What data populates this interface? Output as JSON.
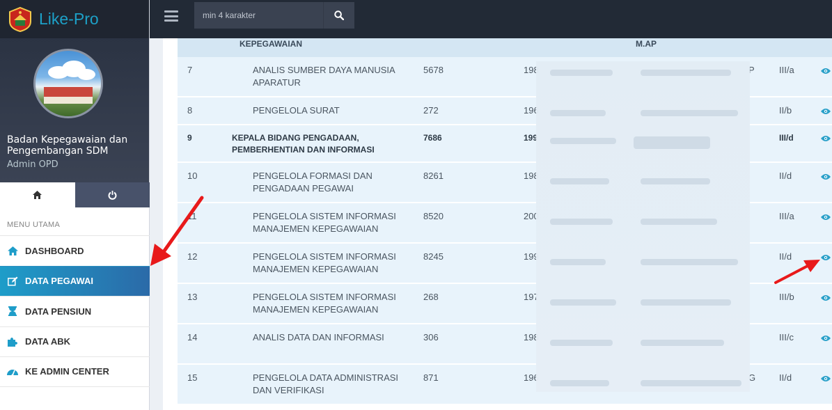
{
  "app": {
    "title": "Like-Pro"
  },
  "search": {
    "placeholder": "min 4 karakter"
  },
  "profile": {
    "org": "Badan Kepegawaian dan Pengembangan SDM",
    "role": "Admin OPD"
  },
  "sidebar": {
    "header": "MENU UTAMA",
    "items": [
      {
        "label": "DASHBOARD",
        "icon": "dashboard-icon",
        "active": false
      },
      {
        "label": "DATA PEGAWAI",
        "icon": "edit-icon",
        "active": true
      },
      {
        "label": "DATA PENSIUN",
        "icon": "hourglass-icon",
        "active": false
      },
      {
        "label": "DATA ABK",
        "icon": "puzzle-icon",
        "active": false
      },
      {
        "label": "KE ADMIN CENTER",
        "icon": "gauge-icon",
        "active": false
      }
    ]
  },
  "table": {
    "header": {
      "col_jabatan": "KEPEGAWAIAN",
      "col_pendidikan": "M.AP"
    },
    "rows": [
      {
        "no": "7",
        "jabatan": [
          "ANALIS SUMBER DAYA MANUSIA",
          "APARATUR"
        ],
        "kode": "5678",
        "nip": "198",
        "pend_tail": "P",
        "gol": "III/a",
        "bold": false,
        "indent": true
      },
      {
        "no": "8",
        "jabatan": [
          "PENGELOLA SURAT"
        ],
        "kode": "272",
        "nip": "196",
        "pend_tail": "",
        "gol": "II/b",
        "bold": false,
        "indent": true
      },
      {
        "no": "9",
        "jabatan": [
          "KEPALA BIDANG PENGADAAN,",
          "PEMBERHENTIAN DAN INFORMASI"
        ],
        "kode": "7686",
        "nip": "199",
        "pend_tail": "",
        "gol": "III/d",
        "bold": true,
        "indent": false
      },
      {
        "no": "10",
        "jabatan": [
          "PENGELOLA FORMASI DAN",
          "PENGADAAN PEGAWAI"
        ],
        "kode": "8261",
        "nip": "198",
        "pend_tail": "",
        "gol": "II/d",
        "bold": false,
        "indent": true
      },
      {
        "no": "11",
        "jabatan": [
          "PENGELOLA SISTEM INFORMASI",
          "MANAJEMEN KEPEGAWAIAN"
        ],
        "kode": "8520",
        "nip": "200",
        "pend_tail": "",
        "gol": "III/a",
        "bold": false,
        "indent": true
      },
      {
        "no": "12",
        "jabatan": [
          "PENGELOLA SISTEM INFORMASI",
          "MANAJEMEN KEPEGAWAIAN"
        ],
        "kode": "8245",
        "nip": "199",
        "pend_tail": "",
        "gol": "II/d",
        "bold": false,
        "indent": true
      },
      {
        "no": "13",
        "jabatan": [
          "PENGELOLA SISTEM INFORMASI",
          "MANAJEMEN KEPEGAWAIAN"
        ],
        "kode": "268",
        "nip": "197",
        "pend_tail": "",
        "gol": "III/b",
        "bold": false,
        "indent": true
      },
      {
        "no": "14",
        "jabatan": [
          "ANALIS DATA DAN INFORMASI"
        ],
        "kode": "306",
        "nip": "198",
        "pend_tail": "",
        "gol": "III/c",
        "bold": false,
        "indent": true
      },
      {
        "no": "15",
        "jabatan": [
          "PENGELOLA DATA ADMINISTRASI",
          "DAN VERIFIKASI"
        ],
        "kode": "871",
        "nip": "196",
        "pend_tail": "G",
        "gol": "II/d",
        "bold": false,
        "indent": true
      }
    ]
  },
  "colors": {
    "accent": "#1e9dc9",
    "annotation_arrow": "#e8191a",
    "eye_icon": "#2aa0c9"
  }
}
